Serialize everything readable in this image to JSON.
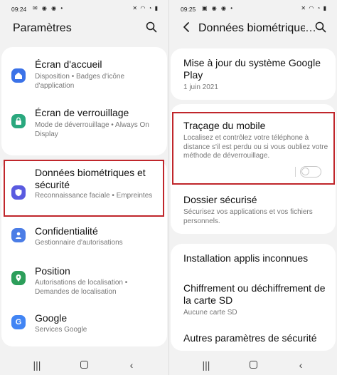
{
  "left_screen": {
    "status": {
      "time": "09:24",
      "left_icons": "✉ ◉ ◉ •",
      "right_icons": "✕ ◠ ◔ ▮"
    },
    "title": "Paramètres",
    "items": [
      {
        "title": "Écran d'accueil",
        "subtitle": "Disposition  •  Badges d'icône d'application",
        "icon": "home-icon",
        "color": "#3b72e8"
      },
      {
        "title": "Écran de verrouillage",
        "subtitle": "Mode de déverrouillage  •  Always On Display",
        "icon": "lock-icon",
        "color": "#2aa87e"
      },
      {
        "title": "Données biométriques et sécurité",
        "subtitle": "Reconnaissance faciale  •  Empreintes",
        "icon": "shield-icon",
        "color": "#5a5be0"
      },
      {
        "title": "Confidentialité",
        "subtitle": "Gestionnaire d'autorisations",
        "icon": "privacy-icon",
        "color": "#4b7de6"
      },
      {
        "title": "Position",
        "subtitle": "Autorisations de localisation  •  Demandes de localisation",
        "icon": "location-icon",
        "color": "#2c9e5a"
      },
      {
        "title": "Google",
        "subtitle": "Services Google",
        "icon": "google-icon",
        "color": "#4285f4"
      }
    ]
  },
  "right_screen": {
    "status": {
      "time": "09:25",
      "left_icons": "▣ ◉ ◉ •",
      "right_icons": "✕ ◠ ◔ ▮"
    },
    "title": "Données biométrique",
    "items": [
      {
        "title": "Mise à jour du système Google Play",
        "subtitle": "1 juin 2021"
      },
      {
        "title": "Traçage du mobile",
        "subtitle": "Localisez et contrôlez votre téléphone à distance s'il est perdu ou si vous oubliez votre méthode de déverrouillage.",
        "toggle_on": false
      },
      {
        "title": "Dossier sécurisé",
        "subtitle": "Sécurisez vos applications et vos fichiers personnels."
      },
      {
        "title": "Installation applis inconnues",
        "subtitle": ""
      },
      {
        "title": "Chiffrement ou déchiffrement de la carte SD",
        "subtitle": "Aucune carte SD"
      },
      {
        "title": "Autres paramètres de sécurité",
        "subtitle": ""
      }
    ]
  },
  "nav_bar": {
    "recents": "|||",
    "back": "‹"
  },
  "highlight_color": "#c0262b"
}
